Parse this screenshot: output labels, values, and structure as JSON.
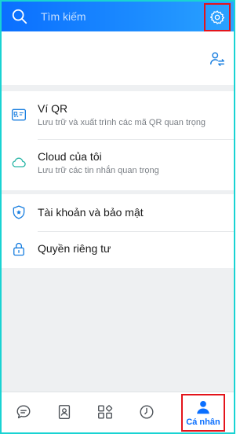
{
  "header": {
    "search_placeholder": "Tìm kiếm",
    "icons": [
      "search-icon",
      "settings-icon"
    ]
  },
  "profile": {
    "switch_account_icon": "switch-account-icon"
  },
  "section1": {
    "items": [
      {
        "title": "Ví QR",
        "subtitle": "Lưu trữ và xuất trình các mã QR quan trọng",
        "icon": "qr-wallet-icon"
      },
      {
        "title": "Cloud của tôi",
        "subtitle": "Lưu trữ các tin nhắn quan trọng",
        "icon": "cloud-icon"
      }
    ]
  },
  "section2": {
    "items": [
      {
        "title": "Tài khoản và bảo mật",
        "icon": "shield-icon"
      },
      {
        "title": "Quyền riêng tư",
        "icon": "lock-icon"
      }
    ]
  },
  "bottom_nav": {
    "items": [
      {
        "icon": "chat-icon"
      },
      {
        "icon": "contacts-icon"
      },
      {
        "icon": "discover-icon"
      },
      {
        "icon": "timeline-icon"
      },
      {
        "icon": "person-icon",
        "label": "Cá nhân",
        "active": true
      }
    ]
  },
  "colors": {
    "header_start": "#0a6fff",
    "accent": "#0a6fff",
    "highlight_box": "#e3141b",
    "icon_blue": "#1a7fe0"
  }
}
